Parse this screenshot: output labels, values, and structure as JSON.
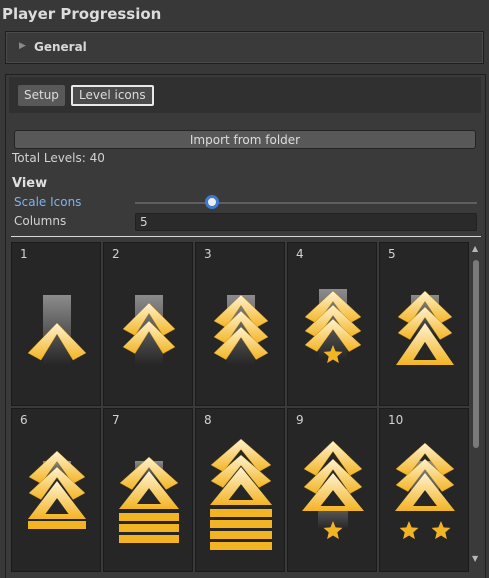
{
  "window": {
    "title": "Player Progression"
  },
  "foldout": {
    "label": "General",
    "arrow_icon": "triangle-right-icon"
  },
  "tabs": [
    {
      "label": "Setup",
      "selected": false
    },
    {
      "label": "Level icons",
      "selected": true
    }
  ],
  "import_button": {
    "label": "Import from folder"
  },
  "total_levels": {
    "text": "Total Levels: 40"
  },
  "view": {
    "heading": "View",
    "scale_icons": {
      "label": "Scale Icons",
      "value_fraction": 0.21
    },
    "columns": {
      "label": "Columns",
      "value": "5"
    }
  },
  "levels": [
    {
      "number": "1",
      "icon": "rank-chevron-1-icon"
    },
    {
      "number": "2",
      "icon": "rank-chevron-2-icon"
    },
    {
      "number": "3",
      "icon": "rank-chevron-3-icon"
    },
    {
      "number": "4",
      "icon": "rank-chevron-3-star-icon"
    },
    {
      "number": "5",
      "icon": "rank-chevron-2-triangle-icon"
    },
    {
      "number": "6",
      "icon": "rank-chevron-2-triangle-bar-icon"
    },
    {
      "number": "7",
      "icon": "rank-chevron-1-triangle-bars-icon"
    },
    {
      "number": "8",
      "icon": "rank-chevron-2-triangle-bars-icon"
    },
    {
      "number": "9",
      "icon": "rank-chevron-2-triangle-star-icon"
    },
    {
      "number": "10",
      "icon": "rank-chevron-1-triangle-2-stars-icon"
    }
  ],
  "colors": {
    "accent": "#3c7bd0",
    "link_label": "#7fb2ef",
    "gold": "#f3b423",
    "gold_light": "#fff3d2"
  }
}
